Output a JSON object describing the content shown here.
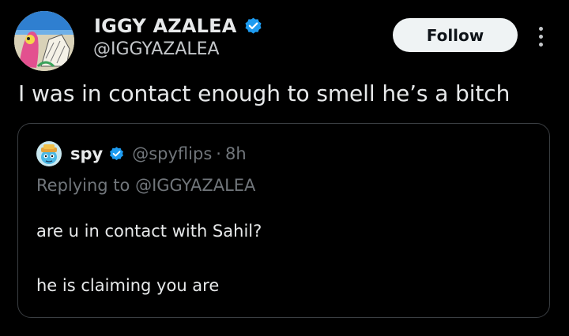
{
  "tweet": {
    "author_name": "IGGY AZALEA",
    "author_handle": "@IGGYAZALEA",
    "follow_label": "Follow",
    "text": "I was in contact enough to smell he’s a bitch",
    "verified_icon": "verified-badge-icon",
    "more_icon": "more-options-icon"
  },
  "quote": {
    "author_name": "spy",
    "author_handle": "@spyflips",
    "separator": "·",
    "time": "8h",
    "replying_to": "Replying to @IGGYAZALEA",
    "lines": [
      "are u in contact with Sahil?",
      "he is claiming you are"
    ]
  },
  "colors": {
    "background": "#000000",
    "primary_text": "#e7e9ea",
    "secondary_text": "#71767b",
    "verified_blue": "#1d9bf0",
    "follow_bg": "#eff3f4",
    "border": "#3a3e42"
  }
}
